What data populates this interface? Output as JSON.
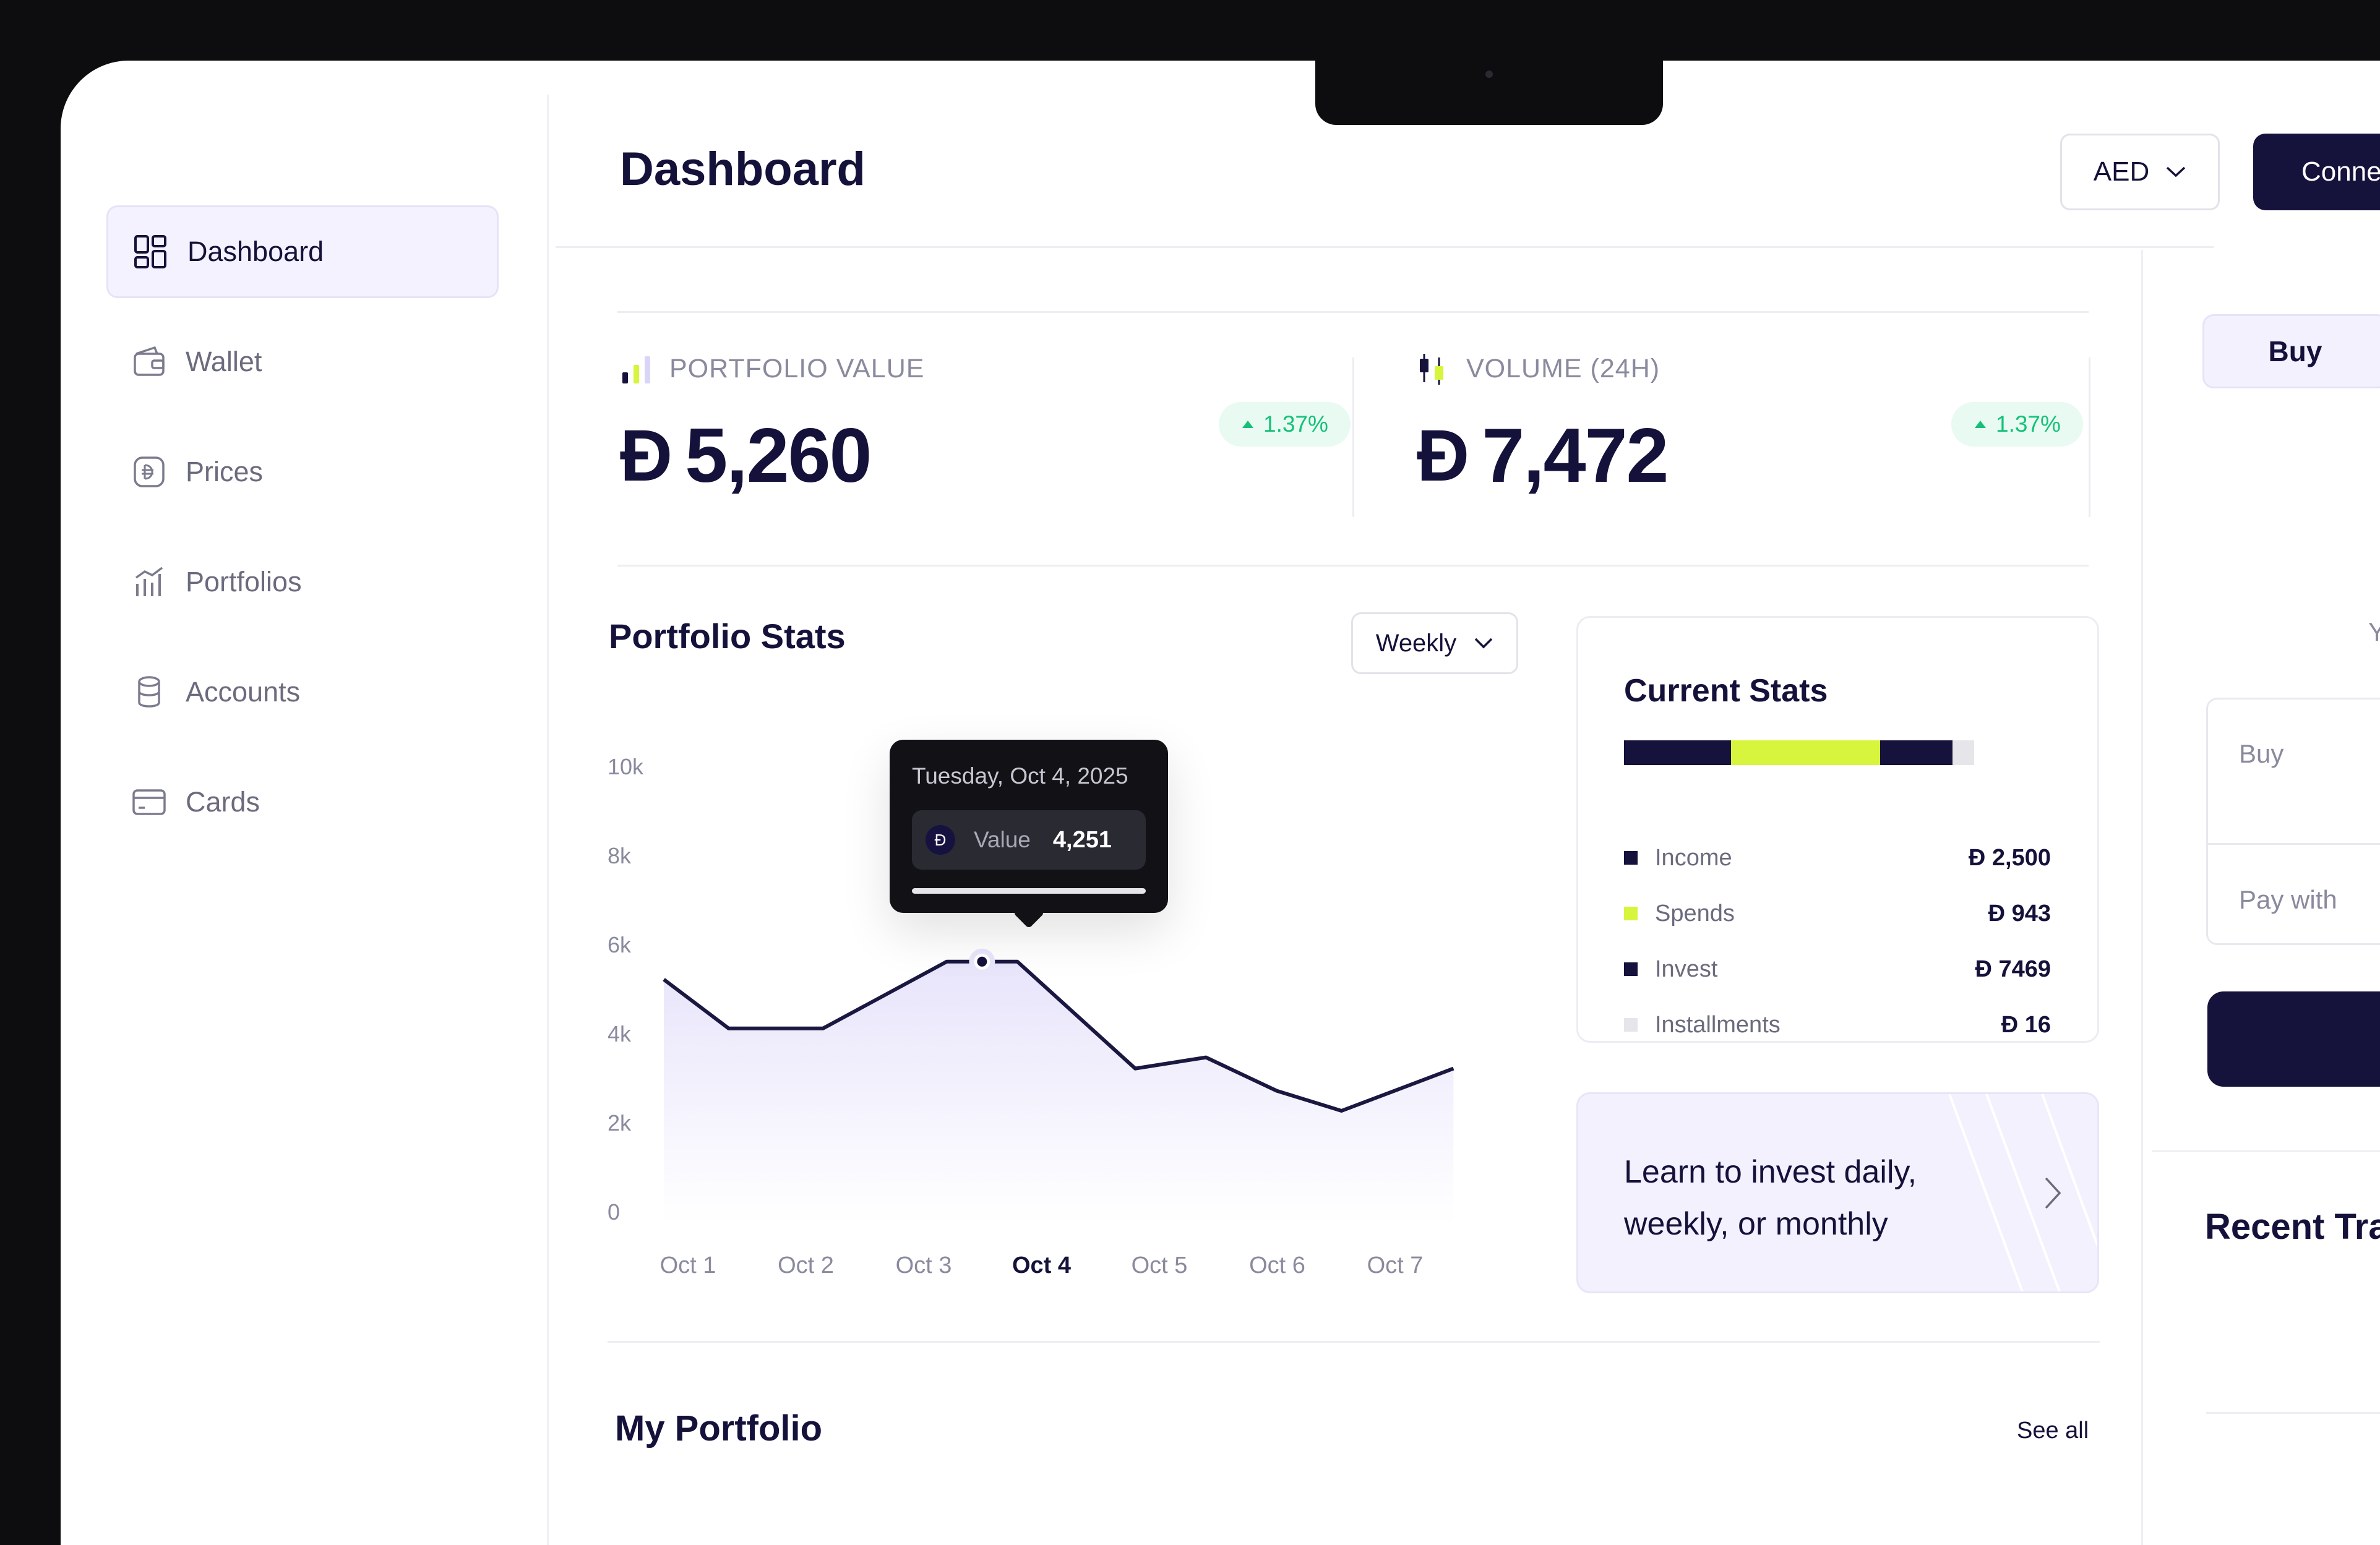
{
  "sidebar": {
    "items": [
      {
        "label": "Dashboard",
        "icon": "grid-icon",
        "active": true
      },
      {
        "label": "Wallet",
        "icon": "wallet-icon",
        "active": false
      },
      {
        "label": "Prices",
        "icon": "dirham-coin-icon",
        "active": false
      },
      {
        "label": "Portfolios",
        "icon": "portfolio-chart-icon",
        "active": false
      },
      {
        "label": "Accounts",
        "icon": "database-icon",
        "active": false
      },
      {
        "label": "Cards",
        "icon": "card-icon",
        "active": false
      }
    ]
  },
  "header": {
    "title": "Dashboard",
    "currency": "AED",
    "connect_label": "Conne"
  },
  "metrics": [
    {
      "label": "PORTFOLIO VALUE",
      "currency_symbol": "Ð",
      "value": "5,260",
      "delta": "1.37%",
      "icon": "bar-chart-icon"
    },
    {
      "label": "VOLUME (24H)",
      "currency_symbol": "Ð",
      "value": "7,472",
      "delta": "1.37%",
      "icon": "candlestick-icon"
    }
  ],
  "portfolio_stats": {
    "title": "Portfolio Stats",
    "range": "Weekly",
    "tooltip": {
      "date": "Tuesday, Oct 4, 2025",
      "value_label": "Value",
      "value": "4,251",
      "coin_symbol": "Ð"
    }
  },
  "chart_data": {
    "type": "area",
    "title": "Portfolio Stats",
    "x": [
      "Oct 1",
      "Oct 2",
      "Oct 3",
      "Oct 4",
      "Oct 5",
      "Oct 6",
      "Oct 7"
    ],
    "y_ticks": [
      "10k",
      "8k",
      "6k",
      "4k",
      "2k",
      "0"
    ],
    "ylim": [
      0,
      10000
    ],
    "highlighted_x": "Oct 4",
    "series": [
      {
        "points": [
          [
            0.0,
            5200
          ],
          [
            0.55,
            4100
          ],
          [
            1.35,
            4100
          ],
          [
            2.4,
            5600
          ],
          [
            2.7,
            5600
          ],
          [
            3.0,
            5600
          ],
          [
            4.0,
            3200
          ],
          [
            4.6,
            3450
          ],
          [
            5.2,
            2700
          ],
          [
            5.75,
            2250
          ],
          [
            6.7,
            3200
          ]
        ]
      }
    ],
    "grid": false,
    "colors": {
      "line": "#1a1840",
      "fill": "#ece9fb"
    }
  },
  "current_stats": {
    "title": "Current Stats",
    "items": [
      {
        "name": "Income",
        "amount": "Ð 2,500",
        "value": 2500,
        "color": "#15123c"
      },
      {
        "name": "Spends",
        "amount": "Ð 943",
        "value": 943,
        "color": "#d6f53c"
      },
      {
        "name": "Invest",
        "amount": "Ð 7469",
        "value": 7469,
        "color": "#15123c"
      },
      {
        "name": "Installments",
        "amount": "Ð 16",
        "value": 16,
        "color": "#e6e6ea"
      }
    ],
    "bar_segments": [
      0.25,
      0.35,
      0.17,
      0.05
    ]
  },
  "learn_card": {
    "text": "Learn to invest daily, weekly, or monthly"
  },
  "my_portfolio": {
    "title": "My Portfolio",
    "see_all": "See all"
  },
  "trade_panel": {
    "tab_buy": "Buy",
    "hint": "Y",
    "buy_label": "Buy",
    "pay_with_label": "Pay with",
    "recent_title": "Recent Tra"
  },
  "colors": {
    "accent": "#15123c",
    "lime": "#d6f53c",
    "positive": "#16c07a"
  }
}
